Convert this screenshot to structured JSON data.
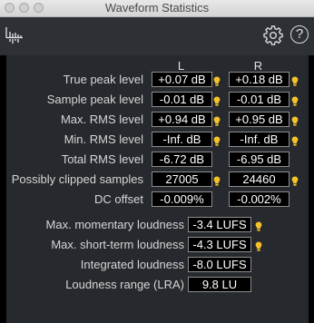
{
  "window": {
    "title": "Waveform Statistics"
  },
  "toolbar": {
    "logo_icon": "waveform-logo-icon",
    "settings_icon": "gear-icon",
    "help_label": "?"
  },
  "columns": {
    "left": "L",
    "right": "R"
  },
  "channel_stats": [
    {
      "label": "True peak level",
      "left": "+0.07 dB",
      "right": "+0.18 dB",
      "left_marker": true,
      "right_marker": true
    },
    {
      "label": "Sample peak level",
      "left": "-0.01 dB",
      "right": "-0.01 dB",
      "left_marker": true,
      "right_marker": true
    },
    {
      "label": "Max. RMS level",
      "left": "+0.94 dB",
      "right": "+0.95 dB",
      "left_marker": true,
      "right_marker": true
    },
    {
      "label": "Min. RMS level",
      "left": "-Inf. dB",
      "right": "-Inf. dB",
      "left_marker": true,
      "right_marker": true
    },
    {
      "label": "Total RMS level",
      "left": "-6.72 dB",
      "right": "-6.95 dB",
      "left_marker": false,
      "right_marker": false
    },
    {
      "label": "Possibly clipped samples",
      "left": "27005",
      "right": "24460",
      "left_marker": true,
      "right_marker": true
    },
    {
      "label": "DC offset",
      "left": "-0.009%",
      "right": "-0.002%",
      "left_marker": false,
      "right_marker": false
    }
  ],
  "loudness_stats": [
    {
      "label": "Max. momentary loudness",
      "value": "-3.4 LUFS",
      "marker": true
    },
    {
      "label": "Max. short-term loudness",
      "value": "-4.3 LUFS",
      "marker": true
    },
    {
      "label": "Integrated loudness",
      "value": "-8.0 LUFS",
      "marker": false
    },
    {
      "label": "Loudness range (LRA)",
      "value": "9.8 LU",
      "marker": false
    }
  ],
  "colors": {
    "marker": "#f5c12b",
    "panel": "#26292d",
    "toolbar": "#2d3136"
  }
}
